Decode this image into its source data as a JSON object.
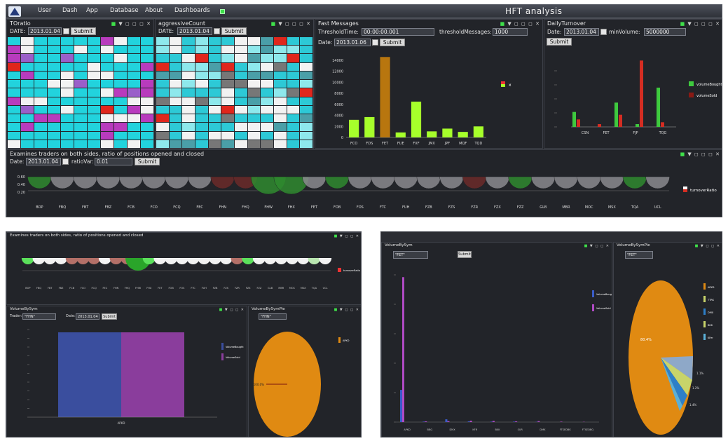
{
  "app": {
    "title": "HFT analysis",
    "menu": [
      "User",
      "Dash",
      "App",
      "Database",
      "About",
      "Dashboards"
    ]
  },
  "colors": {
    "cyan": "#22d3dd",
    "magenta": "#b83bbd",
    "white": "#f2f2f2",
    "red": "#e0261c",
    "green": "#3fe04a"
  },
  "panels": {
    "toratio": {
      "title": "TOratio",
      "date_label": "DATE:",
      "date": "2013.01.04",
      "submit": "Submit"
    },
    "aggressive": {
      "title": "aggressiveCount",
      "date_label": "DATE:",
      "date": "2013.01.04",
      "submit": "Submit"
    },
    "fast": {
      "title": "Fast Messages",
      "threshold_time_label": "ThresholdTime:",
      "threshold_time": "00:00:00.001",
      "threshold_msg_label": "thresholdMessages:",
      "threshold_msg": "1000",
      "date_label": "Date:",
      "date": "2013.01.06",
      "submit": "Submit"
    },
    "turnover": {
      "title": "DailyTurnover",
      "date_label": "Date:",
      "date": "2013.01.04",
      "min_volume_label": "minVolume:",
      "min_volume": "5000000",
      "submit": "Submit"
    },
    "ratio": {
      "title": "Examines traders on both sides, ratio of positions opened and closed",
      "date_label": "Date:",
      "date": "2013.01.04",
      "ratio_label": "ratioVar:",
      "ratio": "0.01",
      "submit": "Submit"
    }
  },
  "chart_data": [
    {
      "type": "bar",
      "categories": [
        "FCO",
        "FDS",
        "FET",
        "FUE",
        "FXF",
        "JMX",
        "JPF",
        "MQF",
        "TQD"
      ],
      "values": [
        3200,
        3700,
        14600,
        900,
        6500,
        1100,
        1600,
        1000,
        2000
      ],
      "yticks": [
        "0",
        "2000",
        "4000",
        "6000",
        "8000",
        "10000",
        "12000",
        "14000"
      ],
      "ylim": [
        0,
        14000
      ],
      "legend": [
        "x"
      ]
    },
    {
      "type": "bar",
      "categories": [
        "CSN",
        "FET",
        "FJP",
        "TQG"
      ],
      "series": [
        {
          "name": "volumeBought",
          "values": [
            1.6,
            0,
            2.6,
            0.3,
            4.2
          ]
        },
        {
          "name": "volumeSold",
          "values": [
            0.8,
            0.3,
            1.3,
            7.1,
            0.5
          ]
        }
      ]
    },
    {
      "type": "scatter",
      "categories": [
        "BOP",
        "FBQ",
        "FBT",
        "FBZ",
        "FCB",
        "FCO",
        "FCQ",
        "FEC",
        "FHN",
        "FHQ",
        "FHW",
        "FHX",
        "FET",
        "FOB",
        "FOS",
        "FTC",
        "FUH",
        "FZB",
        "FZS",
        "FZR",
        "FZX",
        "FZZ",
        "GLB",
        "MBR",
        "MOC",
        "MSX",
        "TQA",
        "UCL"
      ],
      "legend": [
        "turnoverRatio"
      ],
      "yticks": [
        "0.60",
        "0.40",
        "0.20"
      ]
    },
    {
      "type": "bar",
      "title": "VolumeBySym",
      "categories": [
        "APKD"
      ],
      "series": [
        {
          "name": "VolumeBought",
          "values": [
            1
          ]
        },
        {
          "name": "VolumeSold",
          "values": [
            1
          ]
        }
      ]
    },
    {
      "type": "pie",
      "title": "VolumeBySymPie",
      "labels": [
        "APKD"
      ],
      "values": [
        100
      ],
      "slice_labels": [
        "100.0%"
      ]
    },
    {
      "type": "bar",
      "title": "VolumeBySym",
      "categories": [
        "APKD",
        "BBQ",
        "DMX",
        "KFR",
        "BKK",
        "SUR",
        "DMK",
        "FTSEDBK",
        "FTSEDBQ"
      ],
      "series": [
        {
          "name": "VolumeBought",
          "values": [
            14,
            0.2,
            1.2,
            0.3,
            0.2,
            0.2,
            0.1,
            0,
            0
          ]
        },
        {
          "name": "VolumeSold",
          "values": [
            63,
            0.3,
            0.4,
            0.6,
            0.5,
            0.3,
            0.4,
            0.2,
            0.1
          ]
        }
      ]
    },
    {
      "type": "pie",
      "title": "VolumeBySymPie",
      "labels": [
        "APKD",
        "TTRK",
        "DMX",
        "BKK",
        "KFer"
      ],
      "values": [
        80,
        5,
        4,
        4,
        7
      ],
      "slice_labels": [
        "80.4%",
        "1.1%",
        "1.2%",
        "1.4%"
      ]
    }
  ],
  "lower": {
    "left_ratio_title": "Examines traders on both sides, ratio of positions opened and closed",
    "left_vol_title": "VolumeBySym",
    "left_vol_trader_label": "Trader:",
    "left_vol_trader": "\"FHN\"",
    "left_vol_date_label": "Date:",
    "left_vol_date": "2013.01.04",
    "left_pie_title": "VolumeBySymPie",
    "left_pie_trader": "\"FHN\"",
    "right_vol_title": "VolumeBySym",
    "right_vol_trader": "\"FET\"",
    "right_pie_title": "VolumeBySymPie",
    "right_pie_trader": "\"FET\"",
    "submit": "Submit"
  }
}
